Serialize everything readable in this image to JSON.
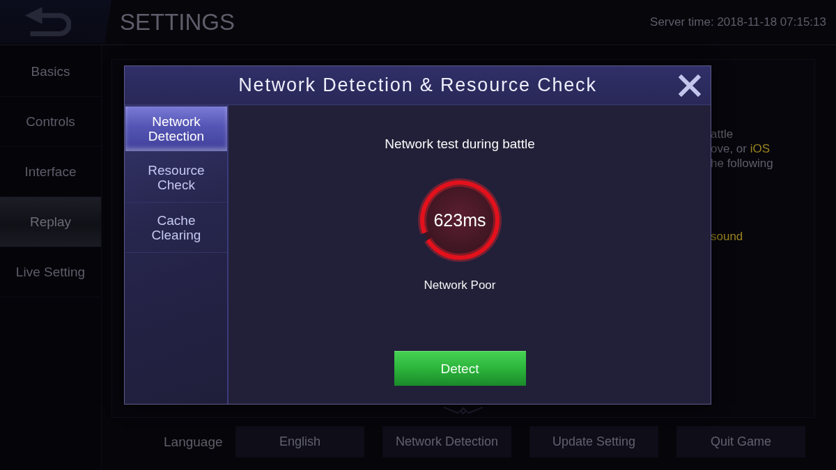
{
  "top_bar": {
    "title": "SETTINGS",
    "server_time": "Server time: 2018-11-18 07:15:13"
  },
  "sidebar": {
    "items": [
      {
        "label": "Basics",
        "selected": false
      },
      {
        "label": "Controls",
        "selected": false
      },
      {
        "label": "Interface",
        "selected": false
      },
      {
        "label": "Replay",
        "selected": true
      },
      {
        "label": "Live Setting",
        "selected": false
      }
    ]
  },
  "settings_panel": {
    "paragraphs": [
      {
        "lines": [
          {
            "parts": [
              {
                "text": "attle",
                "highlight": false
              }
            ]
          },
          {
            "parts": [
              {
                "text": "ove, or ",
                "highlight": false
              },
              {
                "text": "iOS",
                "highlight": true
              }
            ]
          },
          {
            "parts": [
              {
                "text": "he following",
                "highlight": false
              }
            ]
          }
        ]
      },
      {
        "lines": [
          {
            "parts": [
              {
                "text": "sound",
                "highlight": true
              }
            ]
          }
        ]
      }
    ]
  },
  "bottom_bar": {
    "label": "Language",
    "buttons": [
      "English",
      "Network Detection",
      "Update Setting",
      "Quit Game"
    ]
  },
  "dialog": {
    "title": "Network Detection & Resource Check",
    "tabs": [
      {
        "label": "Network Detection",
        "selected": true
      },
      {
        "label": "Resource Check",
        "selected": false
      },
      {
        "label": "Cache Clearing",
        "selected": false
      }
    ],
    "heading": "Network test during battle",
    "latency": "623ms",
    "status": "Network Poor",
    "button": "Detect"
  }
}
